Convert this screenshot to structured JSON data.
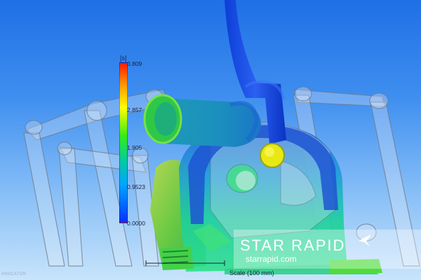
{
  "legend": {
    "unit": "[s]",
    "ticks": [
      "3.809",
      "2.857",
      "1.905",
      "0.9523",
      "0.0000"
    ]
  },
  "branding": {
    "name": "STAR RAPID",
    "url": "starrapid.com"
  },
  "scale": {
    "label": "Scale (100 mm)"
  },
  "corner": {
    "text": "INNICATOR"
  }
}
